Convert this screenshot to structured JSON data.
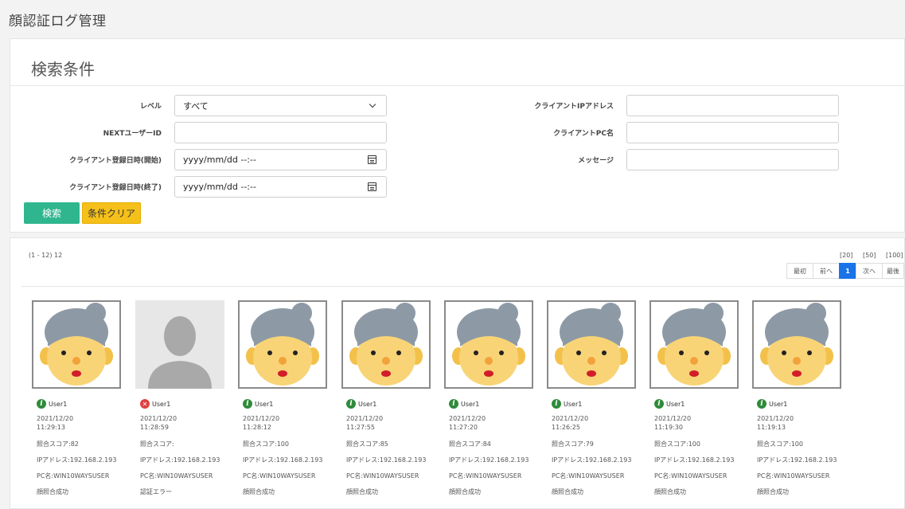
{
  "page": {
    "title": "顔認証ログ管理"
  },
  "search": {
    "title": "検索条件",
    "level": {
      "label": "レベル",
      "value": "すべて"
    },
    "next_user_id": {
      "label": "NEXTユーザーID",
      "value": ""
    },
    "reg_start": {
      "label": "クライアント登録日時(開始)",
      "value": "yyyy/mm/dd --:--"
    },
    "reg_end": {
      "label": "クライアント登録日時(終了)",
      "value": "yyyy/mm/dd --:--"
    },
    "client_ip": {
      "label": "クライアントIPアドレス",
      "value": ""
    },
    "client_pc": {
      "label": "クライアントPC名",
      "value": ""
    },
    "message": {
      "label": "メッセージ",
      "value": ""
    },
    "search_button": "検索",
    "clear_button": "条件クリア"
  },
  "results": {
    "count": "(1 - 12) 12",
    "page_sizes": [
      "[20]",
      "[50]",
      "[100]"
    ],
    "pager": [
      "最初",
      "前へ",
      "1",
      "次へ",
      "最後"
    ],
    "current_page": "1",
    "items": [
      {
        "status": "info",
        "user": "User1",
        "date": "2021/12/20",
        "time": "11:29:13",
        "score": "照合スコア:82",
        "ip": "IPアドレス:192.168.2.193",
        "pc": "PC名:WIN10WAYSUSER",
        "message": "顔照合成功"
      },
      {
        "status": "error",
        "user": "User1",
        "date": "2021/12/20",
        "time": "11:28:59",
        "score": "照合スコア:",
        "ip": "IPアドレス:192.168.2.193",
        "pc": "PC名:WIN10WAYSUSER",
        "message": "認証エラー"
      },
      {
        "status": "info",
        "user": "User1",
        "date": "2021/12/20",
        "time": "11:28:12",
        "score": "照合スコア:100",
        "ip": "IPアドレス:192.168.2.193",
        "pc": "PC名:WIN10WAYSUSER",
        "message": "顔照合成功"
      },
      {
        "status": "info",
        "user": "User1",
        "date": "2021/12/20",
        "time": "11:27:55",
        "score": "照合スコア:85",
        "ip": "IPアドレス:192.168.2.193",
        "pc": "PC名:WIN10WAYSUSER",
        "message": "顔照合成功"
      },
      {
        "status": "info",
        "user": "User1",
        "date": "2021/12/20",
        "time": "11:27:20",
        "score": "照合スコア:84",
        "ip": "IPアドレス:192.168.2.193",
        "pc": "PC名:WIN10WAYSUSER",
        "message": "顔照合成功"
      },
      {
        "status": "info",
        "user": "User1",
        "date": "2021/12/20",
        "time": "11:26:25",
        "score": "照合スコア:79",
        "ip": "IPアドレス:192.168.2.193",
        "pc": "PC名:WIN10WAYSUSER",
        "message": "顔照合成功"
      },
      {
        "status": "info",
        "user": "User1",
        "date": "2021/12/20",
        "time": "11:19:30",
        "score": "照合スコア:100",
        "ip": "IPアドレス:192.168.2.193",
        "pc": "PC名:WIN10WAYSUSER",
        "message": "顔照合成功"
      },
      {
        "status": "info",
        "user": "User1",
        "date": "2021/12/20",
        "time": "11:19:13",
        "score": "照合スコア:100",
        "ip": "IPアドレス:192.168.2.193",
        "pc": "PC名:WIN10WAYSUSER",
        "message": "顔照合成功"
      }
    ]
  }
}
